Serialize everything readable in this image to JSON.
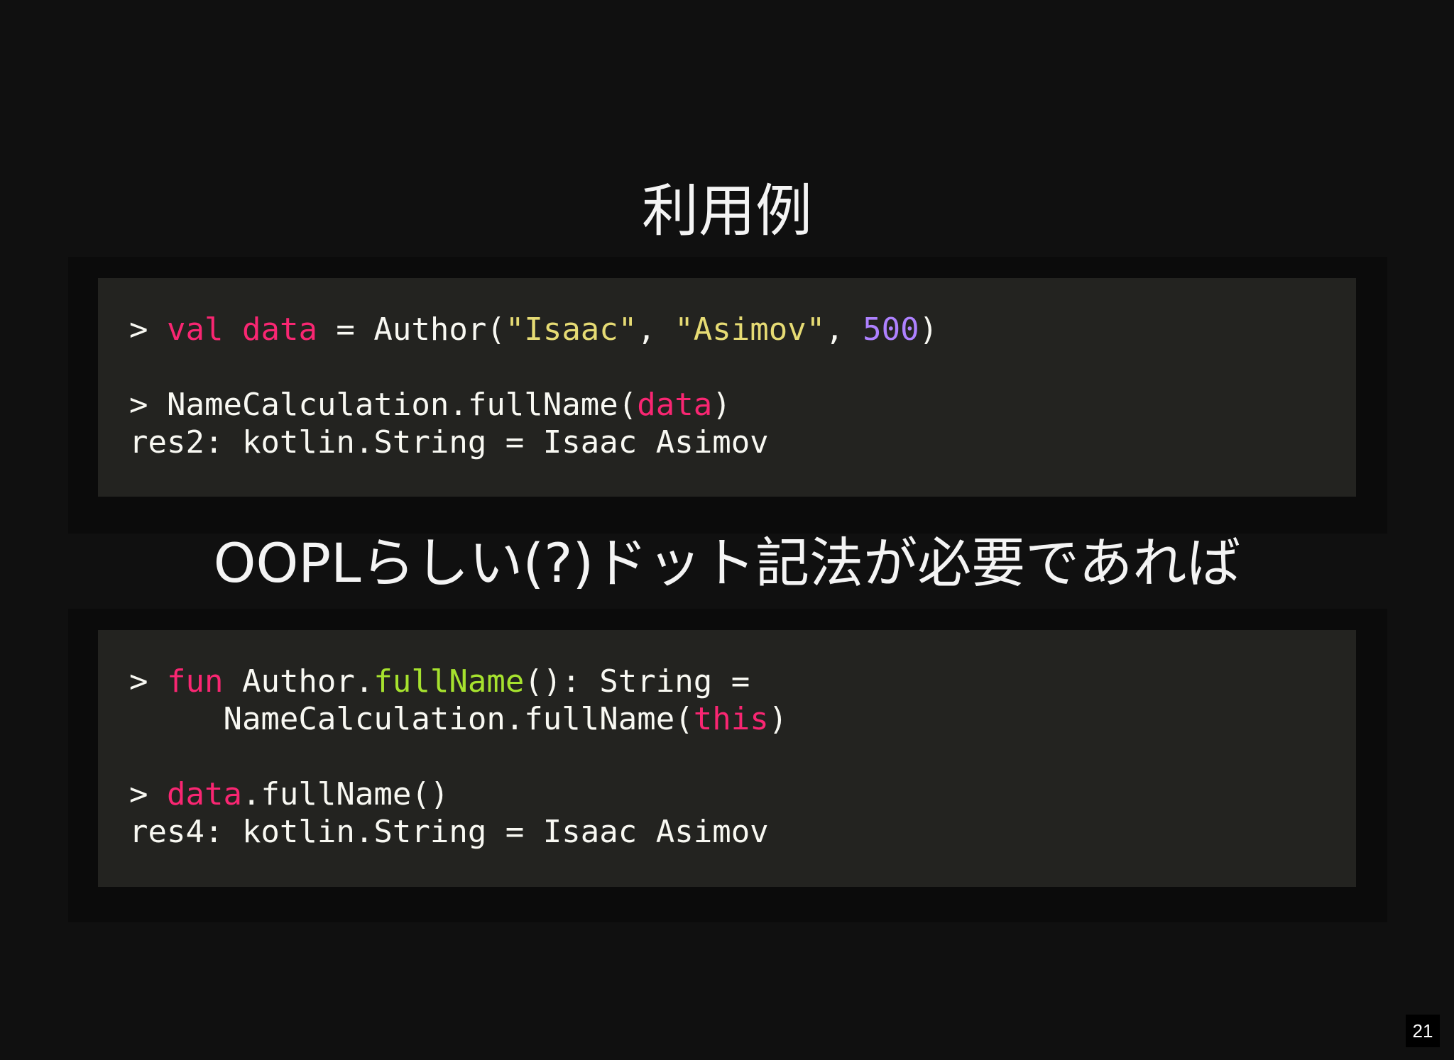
{
  "slide": {
    "title_1": "利用例",
    "title_2": "OOPLらしい(?)ドット記法が必要であれば",
    "page_number": "21"
  },
  "code_block_1": {
    "line1": {
      "prompt": "> ",
      "kw_val": "val",
      "sp1": " ",
      "var_data": "data",
      "eq": " = Author(",
      "str_isaac": "\"Isaac\"",
      "comma1": ", ",
      "str_asimov": "\"Asimov\"",
      "comma2": ", ",
      "num_500": "500",
      "close": ")"
    },
    "line3": {
      "prompt": "> ",
      "call": "NameCalculation.fullName(",
      "var_data": "data",
      "close": ")"
    },
    "line4": "res2: kotlin.String = Isaac Asimov"
  },
  "code_block_2": {
    "line1": {
      "prompt": "> ",
      "kw_fun": "fun",
      "recv": " Author.",
      "fn_name": "fullName",
      "sig": "(): String ="
    },
    "line2": {
      "indent": "     ",
      "call": "NameCalculation.fullName(",
      "kw_this": "this",
      "close": ")"
    },
    "line4": {
      "prompt": "> ",
      "var_data": "data",
      "call": ".fullName()"
    },
    "line5": "res4: kotlin.String = Isaac Asimov"
  },
  "colors": {
    "background": "#101010",
    "code_background": "#232320",
    "keyword": "#f92672",
    "string": "#e6db74",
    "number": "#ae81ff",
    "function": "#a6e22e",
    "text": "#f8f8f2"
  }
}
